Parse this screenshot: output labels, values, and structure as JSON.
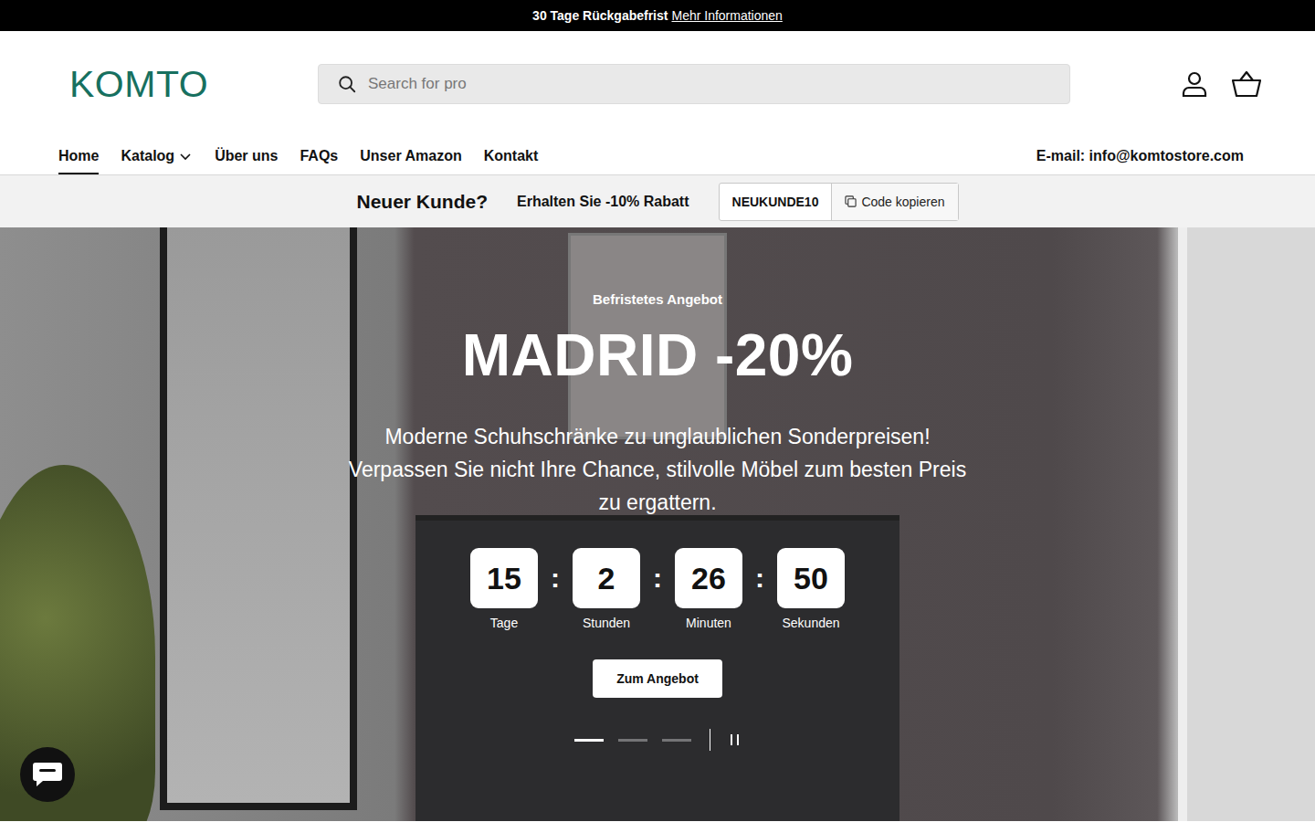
{
  "announcement": {
    "text": "30 Tage Rückgabefrist",
    "link": "Mehr Informationen"
  },
  "header": {
    "logo": "KOMTO",
    "search": {
      "placeholder": "Search for pro"
    }
  },
  "nav": {
    "items": [
      {
        "label": "Home",
        "selected": true,
        "has_dropdown": false
      },
      {
        "label": "Katalog",
        "selected": false,
        "has_dropdown": true
      },
      {
        "label": "Über uns",
        "selected": false,
        "has_dropdown": false
      },
      {
        "label": "FAQs",
        "selected": false,
        "has_dropdown": false
      },
      {
        "label": "Unser Amazon",
        "selected": false,
        "has_dropdown": false
      },
      {
        "label": "Kontakt",
        "selected": false,
        "has_dropdown": false
      }
    ],
    "email": "E-mail: info@komtostore.com"
  },
  "promo": {
    "title": "Neuer Kunde?",
    "text": "Erhalten Sie -10% Rabatt",
    "code": "NEUKUNDE10",
    "copy": "Code kopieren"
  },
  "hero": {
    "eyebrow": "Befristetes Angebot",
    "title": "MADRID -20%",
    "text": "Moderne Schuhschränke zu unglaublichen Sonderpreisen! Verpassen Sie nicht Ihre Chance, stilvolle Möbel zum besten Preis zu ergattern.",
    "countdown": [
      {
        "value": "15",
        "unit": "Tage"
      },
      {
        "value": "2",
        "unit": "Stunden"
      },
      {
        "value": "26",
        "unit": "Minuten"
      },
      {
        "value": "50",
        "unit": "Sekunden"
      }
    ],
    "separator": ":",
    "button": "Zum Angebot",
    "slides": [
      {
        "selected": true
      },
      {
        "selected": false
      },
      {
        "selected": false
      }
    ]
  }
}
